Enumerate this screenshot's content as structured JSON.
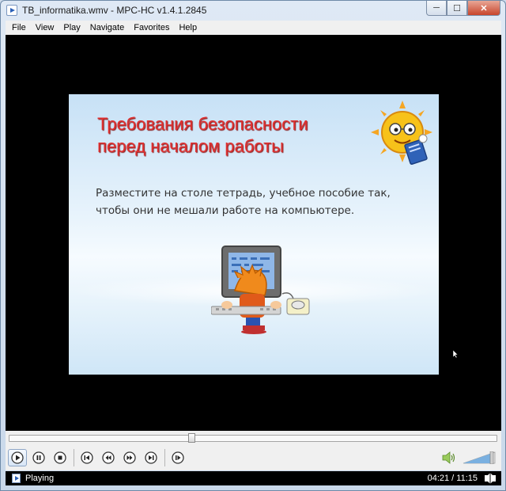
{
  "window": {
    "title": "TB_informatika.wmv - MPC-HC v1.4.1.2845",
    "controls": {
      "minimize": "─",
      "maximize": "☐",
      "close": "✕"
    }
  },
  "menu": {
    "items": [
      "File",
      "View",
      "Play",
      "Navigate",
      "Favorites",
      "Help"
    ]
  },
  "slide": {
    "title_line1": "Требования безопасности",
    "title_line2": "перед началом работы",
    "body_line1": "Разместите на столе тетрадь, учебное пособие так,",
    "body_line2": "чтобы они не мешали работе на компьютере."
  },
  "playback": {
    "seek_fraction": 0.373,
    "volume_fraction": 0.9,
    "buttons": [
      "play",
      "pause",
      "stop",
      "previous",
      "rewind",
      "fast-forward",
      "next",
      "frame-step"
    ]
  },
  "status": {
    "state": "Playing",
    "time": "04:21 / 11:15"
  },
  "colors": {
    "title_red": "#e03030",
    "status_bg": "#000000",
    "slide_bg": "#e9f4fc"
  }
}
